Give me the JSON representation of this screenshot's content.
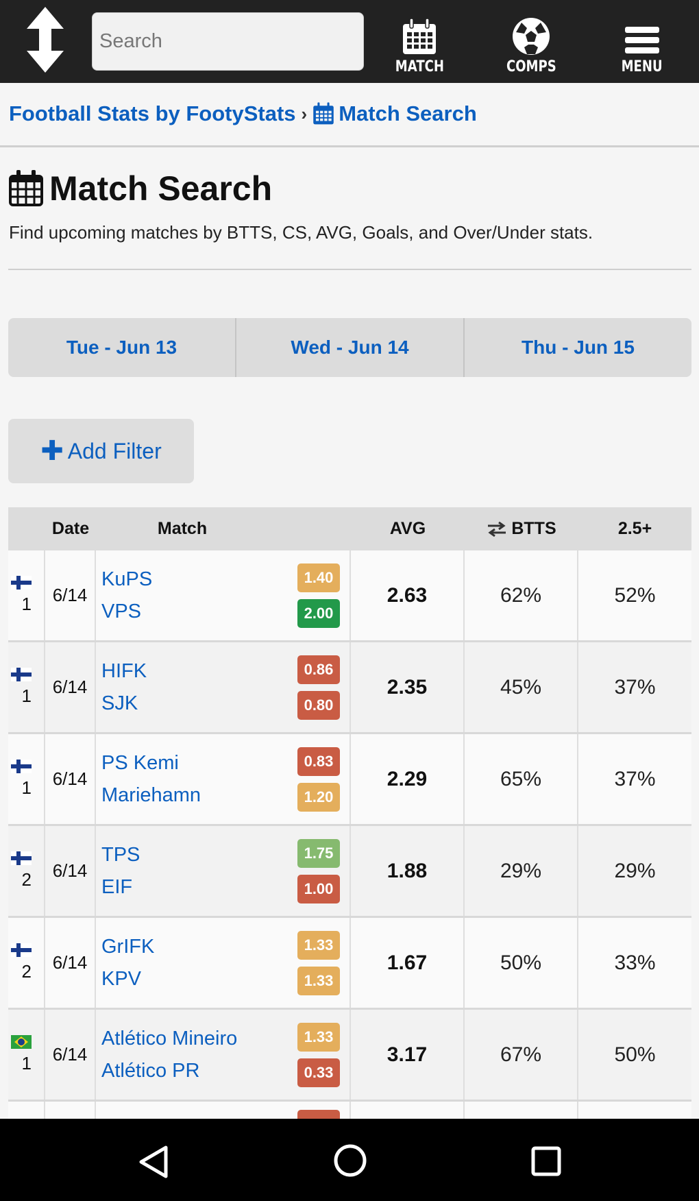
{
  "topbar": {
    "search_placeholder": "Search",
    "nav": [
      {
        "label": "MATCH",
        "icon": "calendar-icon"
      },
      {
        "label": "COMPS",
        "icon": "soccer-ball-icon"
      },
      {
        "label": "MENU",
        "icon": "hamburger-menu-icon"
      }
    ]
  },
  "breadcrumb": {
    "home": "Football Stats by FootyStats",
    "separator": "›",
    "current": "Match Search"
  },
  "page": {
    "title": "Match Search",
    "subtitle": "Find upcoming matches by BTTS, CS, AVG, Goals, and Over/Under stats."
  },
  "day_tabs": [
    "Tue - Jun 13",
    "Wed - Jun 14",
    "Thu - Jun 15"
  ],
  "add_filter": {
    "label": "Add Filter"
  },
  "table": {
    "headers": {
      "date": "Date",
      "match": "Match",
      "avg": "AVG",
      "btts": "BTTS",
      "over": "2.5+"
    },
    "badge_colors": {
      "orange": "#e4ae5c",
      "green": "#22994a",
      "light_green": "#86ba6f",
      "red": "#c95c44"
    },
    "rows": [
      {
        "flag": "finland",
        "division": "1",
        "date": "6/14",
        "home": "KuPS",
        "away": "VPS",
        "home_ppg": "1.40",
        "home_color": "#e4ae5c",
        "away_ppg": "2.00",
        "away_color": "#22994a",
        "avg": "2.63",
        "btts": "62%",
        "over": "52%"
      },
      {
        "flag": "finland",
        "division": "1",
        "date": "6/14",
        "home": "HIFK",
        "away": "SJK",
        "home_ppg": "0.86",
        "home_color": "#c95c44",
        "away_ppg": "0.80",
        "away_color": "#c95c44",
        "avg": "2.35",
        "btts": "45%",
        "over": "37%"
      },
      {
        "flag": "finland",
        "division": "1",
        "date": "6/14",
        "home": "PS Kemi",
        "away": "Mariehamn",
        "home_ppg": "0.83",
        "home_color": "#c95c44",
        "away_ppg": "1.20",
        "away_color": "#e4ae5c",
        "avg": "2.29",
        "btts": "65%",
        "over": "37%"
      },
      {
        "flag": "finland",
        "division": "2",
        "date": "6/14",
        "home": "TPS",
        "away": "EIF",
        "home_ppg": "1.75",
        "home_color": "#86ba6f",
        "away_ppg": "1.00",
        "away_color": "#c95c44",
        "avg": "1.88",
        "btts": "29%",
        "over": "29%"
      },
      {
        "flag": "finland",
        "division": "2",
        "date": "6/14",
        "home": "GrIFK",
        "away": "KPV",
        "home_ppg": "1.33",
        "home_color": "#e4ae5c",
        "away_ppg": "1.33",
        "away_color": "#e4ae5c",
        "avg": "1.67",
        "btts": "50%",
        "over": "33%"
      },
      {
        "flag": "brazil",
        "division": "1",
        "date": "6/14",
        "home": "Atlético Mineiro",
        "away": "Atlético PR",
        "home_ppg": "1.33",
        "home_color": "#e4ae5c",
        "away_ppg": "0.33",
        "away_color": "#c95c44",
        "avg": "3.17",
        "btts": "67%",
        "over": "50%"
      }
    ]
  },
  "colors": {
    "link": "#0c5fbf",
    "topbar": "#222222",
    "background": "#f5f5f5"
  }
}
